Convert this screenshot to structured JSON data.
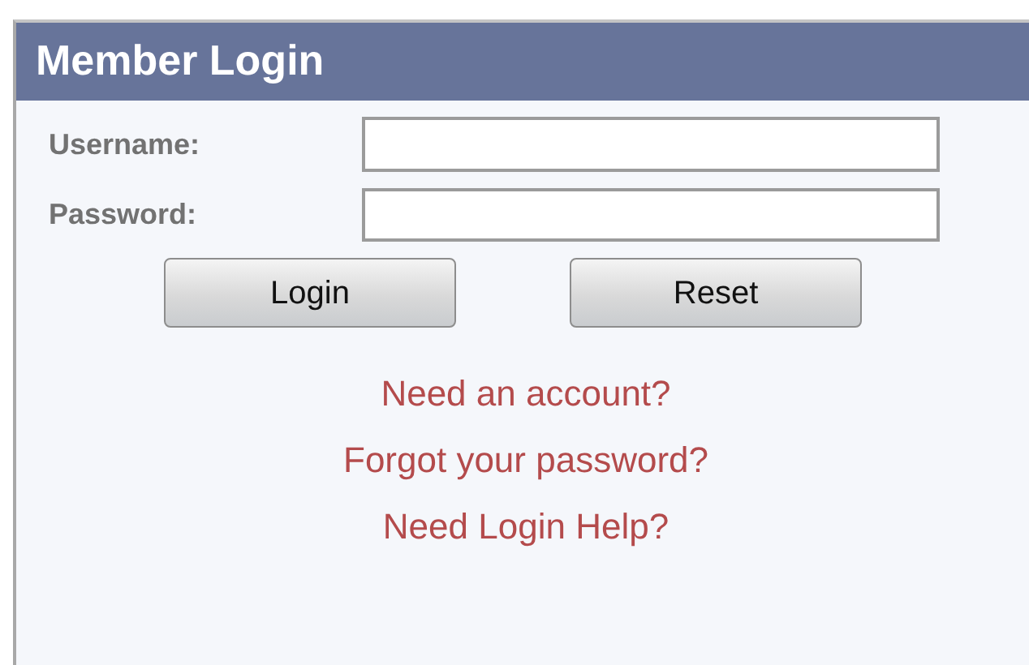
{
  "panel": {
    "title": "Member Login"
  },
  "fields": [
    {
      "label": "Username:"
    },
    {
      "label": "Password:"
    }
  ],
  "buttons": [
    "Login",
    "Reset"
  ],
  "links": [
    "Need an account?",
    "Forgot your password?",
    "Need Login Help?"
  ]
}
